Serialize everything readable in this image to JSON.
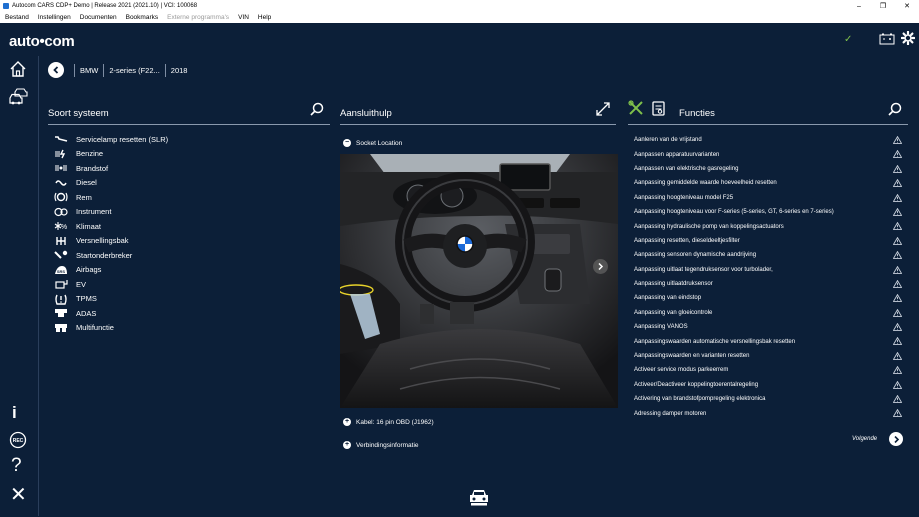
{
  "window": {
    "title": "Autocom CARS CDP+ Demo | Release 2021 (2021.10) | VCI: 100068",
    "controls": [
      "–",
      "❐",
      "✕"
    ]
  },
  "menu": [
    "Bestand",
    "Instellingen",
    "Documenten",
    "Bookmarks",
    "Externe programma's",
    "VIN",
    "Help"
  ],
  "menu_disabled_index": 4,
  "logo": "auto•com",
  "status_check": "✓",
  "vehicle": {
    "make": "BMW",
    "model": "2-series (F22...",
    "year": "2018"
  },
  "left_panel": {
    "title": "Soort systeem",
    "items": [
      {
        "label": "Servicelamp resetten (SLR)",
        "icon": "wrench-icon"
      },
      {
        "label": "Benzine",
        "icon": "petrol-injector-icon"
      },
      {
        "label": "Brandstof",
        "icon": "fuel-system-icon"
      },
      {
        "label": "Diesel",
        "icon": "glow-plug-icon"
      },
      {
        "label": "Rem",
        "icon": "brake-icon"
      },
      {
        "label": "Instrument",
        "icon": "instrument-icon"
      },
      {
        "label": "Klimaat",
        "icon": "climate-icon"
      },
      {
        "label": "Versnellingsbak",
        "icon": "gearbox-icon"
      },
      {
        "label": "Startonderbreker",
        "icon": "immobilizer-key-icon"
      },
      {
        "label": "Airbags",
        "icon": "airbag-icon"
      },
      {
        "label": "EV",
        "icon": "ev-plug-icon"
      },
      {
        "label": "TPMS",
        "icon": "tpms-icon"
      },
      {
        "label": "ADAS",
        "icon": "adas-icon"
      },
      {
        "label": "Multifunctie",
        "icon": "multifunction-icon"
      }
    ]
  },
  "middle_panel": {
    "title": "Aansluithulp",
    "socket_label": "Socket Location",
    "cable_label": "Kabel: 16 pin OBD (J1962)",
    "connection_label": "Verbindingsinformatie"
  },
  "right_panel": {
    "title": "Functies",
    "items": [
      "Aanleren van de vrijstand",
      "Aanpassen apparatuurvarianten",
      "Aanpassen van elektrische gasregeling",
      "Aanpassing gemiddelde waarde hoeveelheid resetten",
      "Aanpassing hoogteniveau model F25",
      "Aanpassing hoogteniveau voor F-series (5-series, GT, 6-series en 7-series)",
      "Aanpassing hydraulische pomp van koppelingsactuators",
      "Aanpassing resetten, dieseldeeltjesfilter",
      "Aanpassing sensoren dynamische aandrijving",
      "Aanpassing uitlaat tegendruksensor voor turbolader,",
      "Aanpassing uitlaatdruksensor",
      "Aanpassing van eindstop",
      "Aanpassing van gloeicontrole",
      "Aanpassing VANOS",
      "Aanpassingswaarden automatische versnellingsbak resetten",
      "Aanpassingswaarden en varianten resetten",
      "Activeer service modus parkeerrem",
      "Activeer/Deactiveer koppelingtoerentalregeling",
      "Activering van brandstofpompregeling elektronica",
      "Adressing damper motoren"
    ],
    "next_label": "Volgende"
  },
  "colors": {
    "background": "#0c1f38",
    "accent_green": "#7fc04b"
  }
}
